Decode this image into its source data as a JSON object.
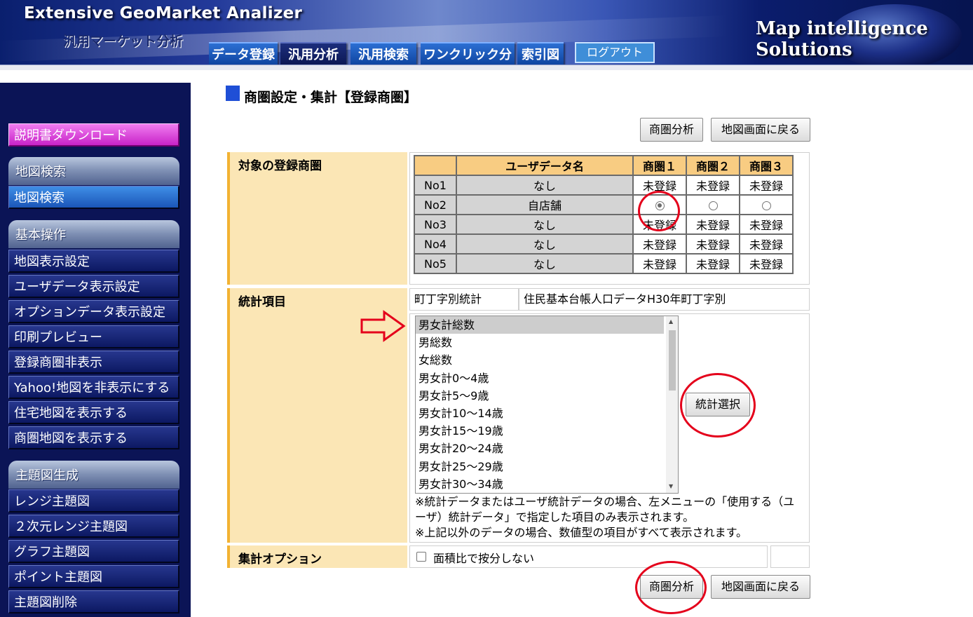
{
  "header": {
    "title": "Extensive GeoMarket Analizer",
    "subtitle": "汎用マーケット分析",
    "brand": "Map intelligence Solutions",
    "tabs": [
      "データ登録",
      "汎用分析",
      "汎用検索",
      "ワンクリック分析",
      "索引図"
    ],
    "logout": "ログアウト"
  },
  "sidebar": {
    "download": "説明書ダウンロード",
    "sections": [
      {
        "title": "地図検索",
        "items": [
          "地図検索"
        ]
      },
      {
        "title": "基本操作",
        "items": [
          "地図表示設定",
          "ユーザデータ表示設定",
          "オプションデータ表示設定",
          "印刷プレビュー",
          "登録商圏非表示",
          "Yahoo!地図を非表示にする",
          "住宅地図を表示する",
          "商圏地図を表示する"
        ]
      },
      {
        "title": "主題図生成",
        "items": [
          "レンジ主題図",
          "２次元レンジ主題図",
          "グラフ主題図",
          "ポイント主題図",
          "主題図削除"
        ]
      }
    ]
  },
  "main": {
    "heading": "商圏設定・集計【登録商圏】",
    "buttons": {
      "analyze": "商圏分析",
      "back": "地図画面に戻る"
    },
    "section_labels": {
      "target": "対象の登録商圏",
      "stats": "統計項目",
      "options": "集計オプション"
    },
    "table": {
      "headers": [
        "",
        "ユーザデータ名",
        "商圏１",
        "商圏２",
        "商圏３"
      ],
      "unregistered": "未登録",
      "rows": [
        {
          "no": "No1",
          "name": "なし"
        },
        {
          "no": "No2",
          "name": "自店舗"
        },
        {
          "no": "No3",
          "name": "なし"
        },
        {
          "no": "No4",
          "name": "なし"
        },
        {
          "no": "No5",
          "name": "なし"
        }
      ]
    },
    "stats": {
      "category": "町丁字別統計",
      "dataset": "住民基本台帳人口データH30年町丁字別",
      "options": [
        "男女計総数",
        "男総数",
        "女総数",
        "男女計0～4歳",
        "男女計5～9歳",
        "男女計10～14歳",
        "男女計15～19歳",
        "男女計20～24歳",
        "男女計25～29歳",
        "男女計30～34歳"
      ],
      "select_button": "統計選択",
      "note": "※統計データまたはユーザ統計データの場合、左メニューの「使用する（ユーザ）統計データ」で指定した項目のみ表示されます。\n※上記以外のデータの場合、数値型の項目がすべて表示されます。"
    },
    "options": {
      "area_ratio_label": "面積比で按分しない"
    }
  },
  "colors": {
    "header_navy": "#0a1f6e",
    "sidebar_bg": "#0b1456",
    "label_bg": "#fbe6b5",
    "label_accent": "#f2b233",
    "table_header": "#f8cc82",
    "annotation_red": "#e4001b"
  }
}
